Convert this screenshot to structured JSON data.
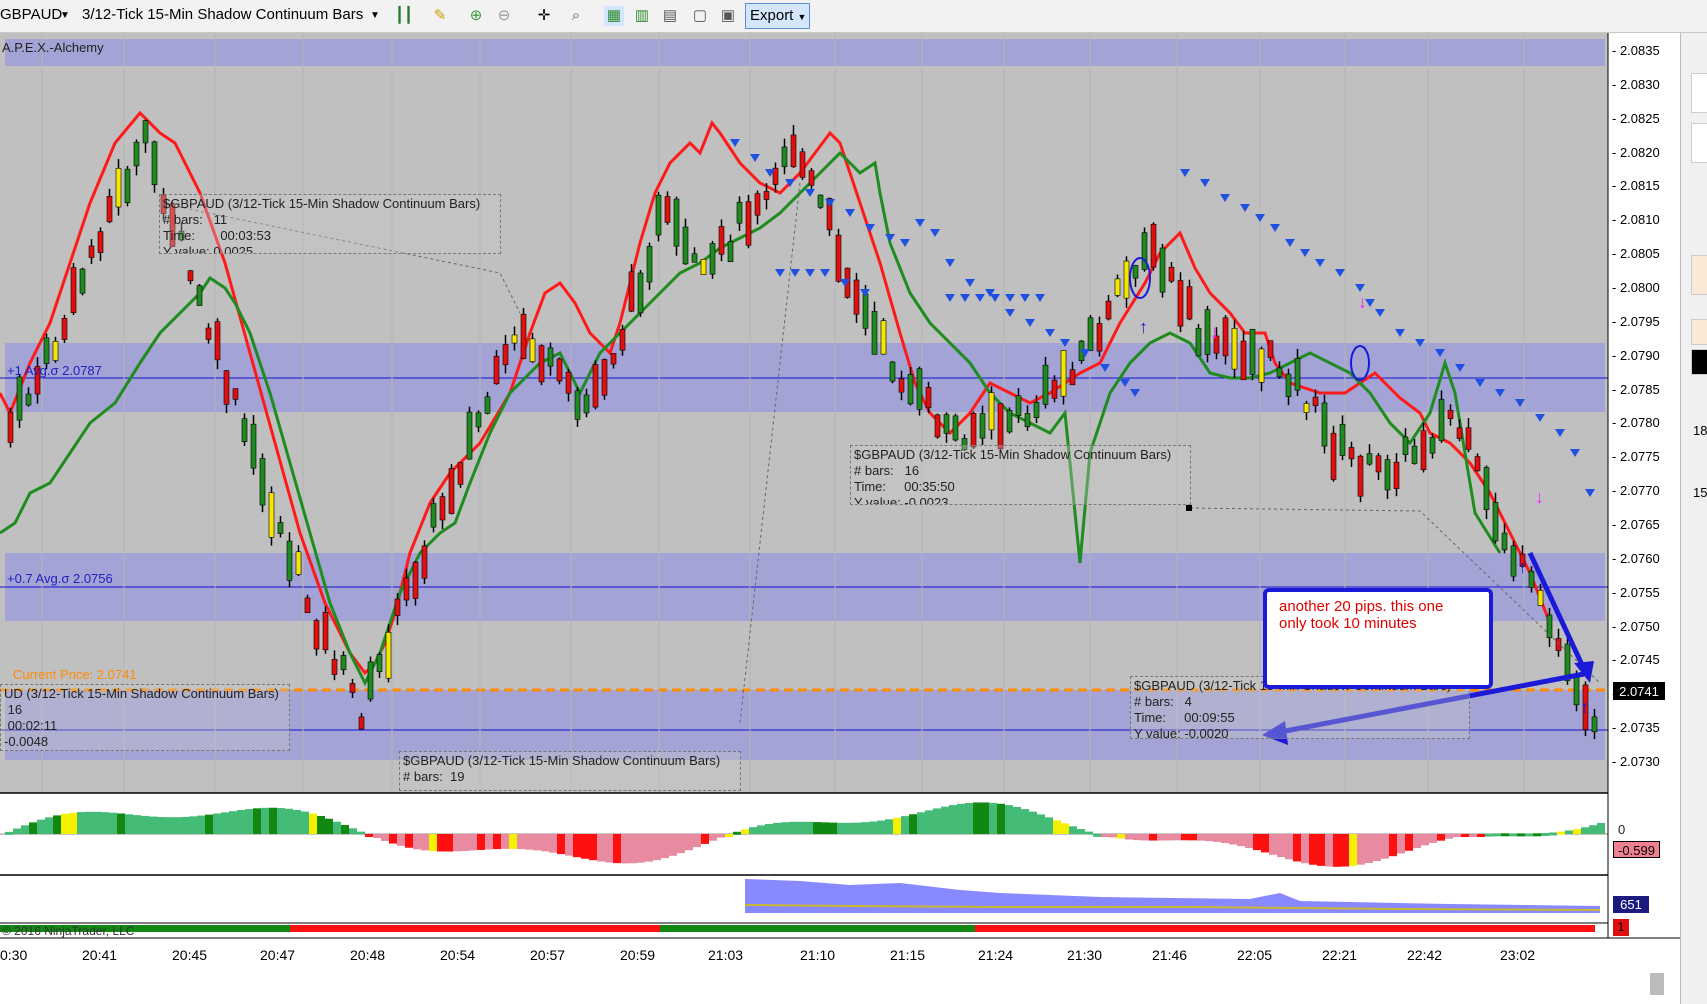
{
  "toolbar": {
    "instrument": "GBPAUD",
    "bar_type": "3/12-Tick 15-Min Shadow Continuum Bars",
    "export_label": "Export"
  },
  "chart": {
    "indicator_label": "A.P.E.X.-Alchemy",
    "band_label_1": "+1 Avg.σ 2.0787",
    "band_label_2": "+0.7 Avg.σ 2.0756",
    "current_price_label": "Current Price: 2.0741",
    "current_price_tag": "2.0741",
    "copyright": "© 2016 NinjaTrader, LLC",
    "osc_zero_label": "0",
    "osc_value_tag": "-0.599",
    "vol_value_tag": "651",
    "bottom_value_tag": "1",
    "price_axis": [
      "2.0835",
      "2.0830",
      "2.0825",
      "2.0820",
      "2.0815",
      "2.0810",
      "2.0805",
      "2.0800",
      "2.0795",
      "2.0790",
      "2.0785",
      "2.0780",
      "2.0775",
      "2.0770",
      "2.0765",
      "2.0760",
      "2.0755",
      "2.0750",
      "2.0745",
      "2.0740",
      "2.0735",
      "2.0730"
    ],
    "time_axis": [
      "0:30",
      "20:41",
      "20:45",
      "20:47",
      "20:48",
      "20:54",
      "20:57",
      "20:59",
      "21:03",
      "21:10",
      "21:15",
      "21:24",
      "21:30",
      "21:46",
      "22:05",
      "22:21",
      "22:42",
      "23:02"
    ],
    "right_panel_values": [
      "18",
      "15"
    ]
  },
  "annotations": [
    {
      "title": "$GBPAUD (3/12-Tick 15-Min Shadow Continuum Bars)",
      "bars_label": "# bars:",
      "bars": "11",
      "time_label": "Time:",
      "time": "00:03:53",
      "y_label": "Y value:",
      "y": "0.0025"
    },
    {
      "title": "UD (3/12-Tick 15-Min Shadow Continuum Bars)",
      "bars": "16",
      "time": "00:02:11",
      "y": "-0.0048"
    },
    {
      "title": "$GBPAUD (3/12-Tick 15-Min Shadow Continuum Bars)",
      "bars_label": "# bars:",
      "bars": "19"
    },
    {
      "title": "$GBPAUD (3/12-Tick 15-Min Shadow Continuum Bars)",
      "bars_label": "# bars:",
      "bars": "16",
      "time_label": "Time:",
      "time": "00:35:50",
      "y_label": "Y value:",
      "y": "-0.0023"
    },
    {
      "title": "$GBPAUD (3/12-Tick 15-Min Shadow Continuum Bars)",
      "bars_label": "# bars:",
      "bars": "4",
      "time_label": "Time:",
      "time": "00:09:55",
      "y_label": "Y value:",
      "y": "-0.0020"
    }
  ],
  "note": {
    "line1": "another 20 pips. this one",
    "line2": "only took 10 minutes"
  },
  "colors": {
    "band": "#9d9ed8",
    "background": "#c0c0c0",
    "up_bar": "#1f8a1f",
    "down_bar": "#e01010",
    "trend_red": "#ff1a1a",
    "trend_green": "#1e8c1e",
    "current_price": "#ff8c00",
    "arrow": "#1a1ad8"
  }
}
